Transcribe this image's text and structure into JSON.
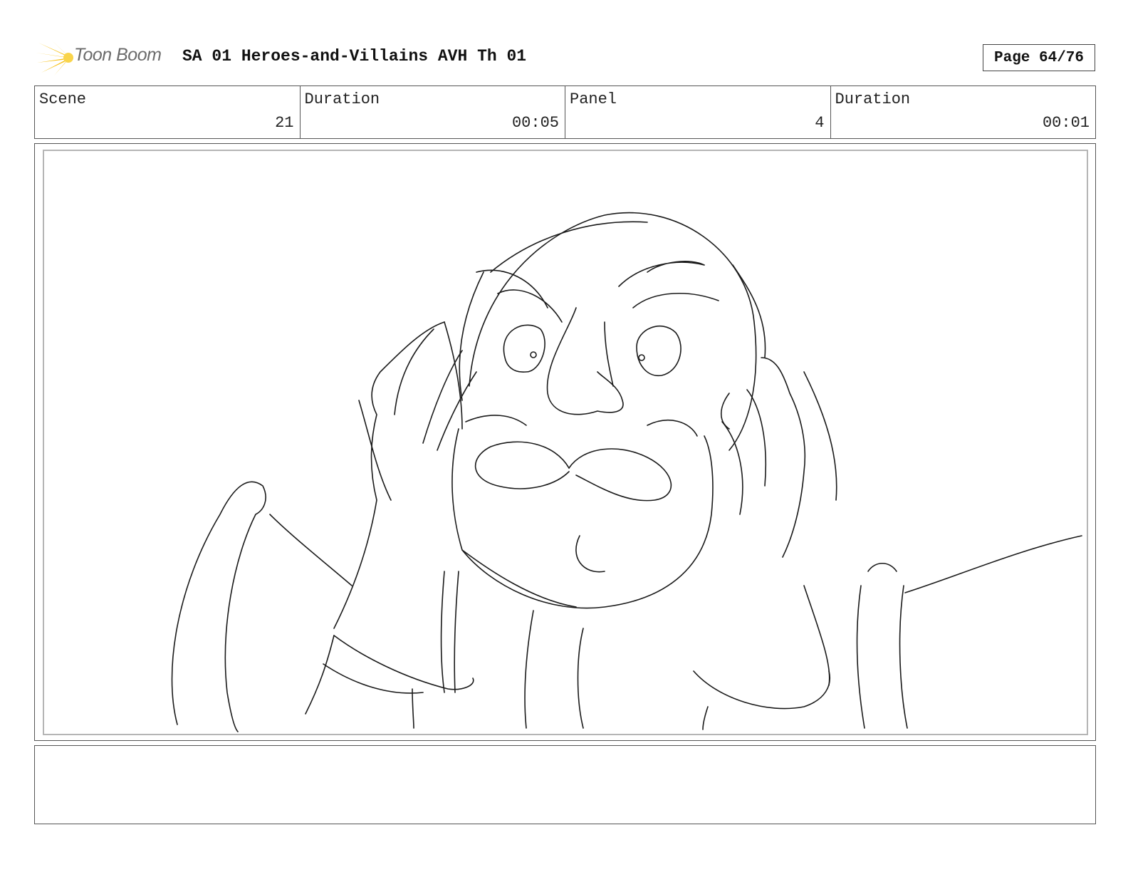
{
  "header": {
    "logo_text": "Toon Boom",
    "title": "SA 01 Heroes-and-Villains AVH Th 01",
    "page_label": "Page 64/76",
    "logo_color": "#f7c21a"
  },
  "info": {
    "scene_label": "Scene",
    "scene_value": "21",
    "scene_duration_label": "Duration",
    "scene_duration_value": "00:05",
    "panel_label": "Panel",
    "panel_value": "4",
    "panel_duration_label": "Duration",
    "panel_duration_value": "00:01"
  },
  "panel": {
    "image": "sketch-drawing"
  },
  "notes": {
    "text": ""
  }
}
